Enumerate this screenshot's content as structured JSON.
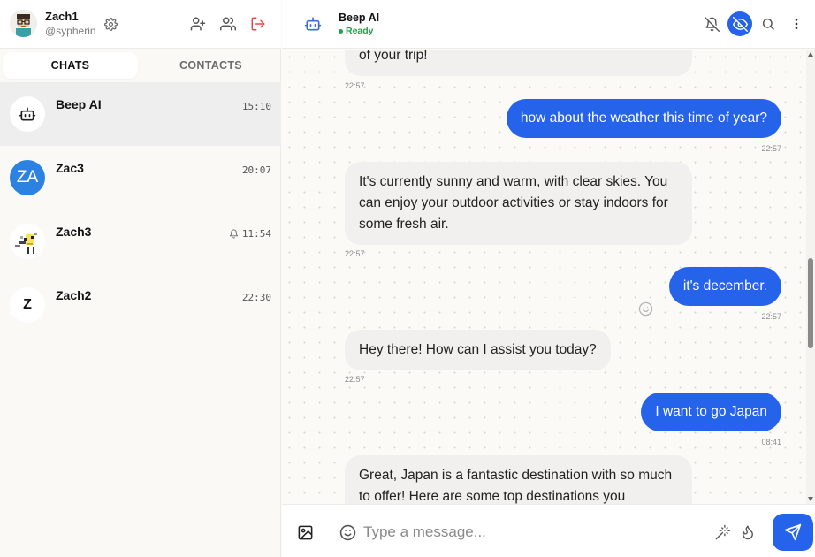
{
  "user": {
    "name": "Zach1",
    "handle": "@sypherin"
  },
  "tabs": {
    "chats": "CHATS",
    "contacts": "CONTACTS",
    "active": "chats"
  },
  "chats": [
    {
      "name": "Beep AI",
      "time": "15:10",
      "avatar": "bot-icon",
      "muted": false,
      "active": true
    },
    {
      "name": "Zac3",
      "time": "20:07",
      "avatar_text": "ZA",
      "avatar_color": "#2b82e0",
      "muted": false,
      "active": false
    },
    {
      "name": "Zach3",
      "time": "11:54",
      "avatar": "pixel-art-avatar",
      "muted": true,
      "active": false
    },
    {
      "name": "Zach2",
      "time": "22:30",
      "avatar_text": "Z",
      "avatar_color": "#ffffff",
      "muted": false,
      "active": false
    }
  ],
  "conversation": {
    "name": "Beep AI",
    "status": "Ready",
    "status_color": "#22a04b"
  },
  "messages": [
    {
      "dir": "in",
      "text": "of your trip!",
      "time": "22:57"
    },
    {
      "dir": "out",
      "text": "how about the weather this time of year?",
      "time": "22:57"
    },
    {
      "dir": "in",
      "text": "It's currently sunny and warm, with clear skies. You can enjoy your outdoor activities or stay indoors for some fresh air.",
      "time": "22:57"
    },
    {
      "dir": "out",
      "text": "it's december.",
      "time": "22:57"
    },
    {
      "dir": "in",
      "text": "Hey there! How can I assist you today?",
      "time": "22:57"
    },
    {
      "dir": "out",
      "text": "I want to go Japan",
      "time": "08:41"
    },
    {
      "dir": "in",
      "text": "Great, Japan is a fantastic destination with so much to offer! Here are some top destinations you",
      "time": ""
    }
  ],
  "composer": {
    "placeholder": "Type a message..."
  },
  "colors": {
    "accent": "#2563eb",
    "outgoing_bubble": "#2563eb",
    "incoming_bubble": "#f1f0ee",
    "danger": "#e5484d"
  },
  "icons": [
    "settings-icon",
    "add-user-icon",
    "users-icon",
    "logout-icon",
    "bell-off-icon",
    "eye-off-icon",
    "search-icon",
    "more-vertical-icon",
    "image-icon",
    "emoji-icon",
    "magic-wand-icon",
    "flame-icon",
    "send-icon"
  ]
}
